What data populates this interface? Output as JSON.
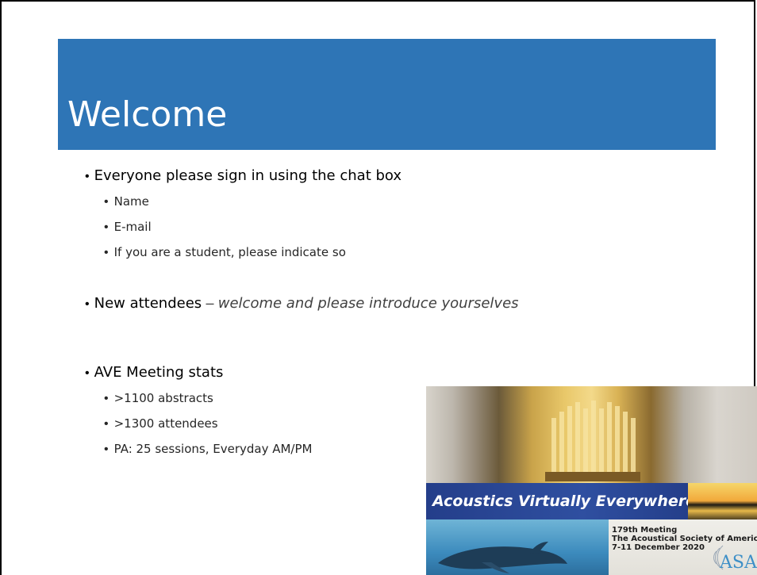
{
  "slide": {
    "title": "Welcome",
    "bullets": [
      {
        "text": "Everyone please sign in using the chat box",
        "sub": [
          "Name",
          "E-mail",
          "If you are a student, please indicate so"
        ]
      },
      {
        "text": "New attendees",
        "dash": "–",
        "emphasis": "welcome and please introduce yourselves"
      },
      {
        "text": "AVE Meeting stats",
        "sub": [
          ">1100 abstracts",
          ">1300 attendees",
          "PA: 25 sessions, Everyday AM/PM"
        ]
      }
    ]
  },
  "promo_image": {
    "banner": "Acoustics Virtually Everywhere",
    "meeting": "179th Meeting",
    "society": "The Acoustical Society of America",
    "dates": "7-11 December 2020",
    "logo": "ASA"
  },
  "colors": {
    "title_bar": "#2e75b6",
    "banner": "#2f4fa0"
  }
}
